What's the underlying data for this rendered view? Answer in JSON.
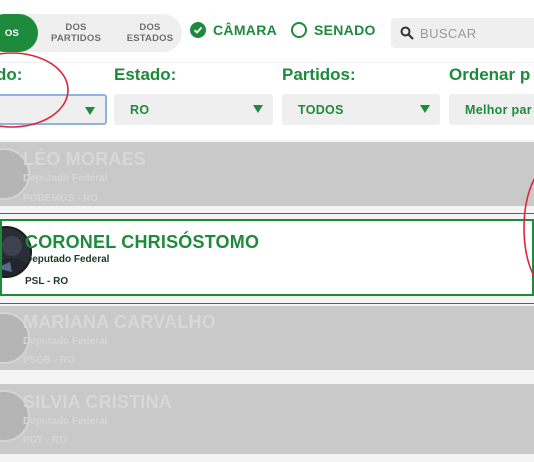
{
  "tabs": [
    {
      "label": "OS",
      "active": true
    },
    {
      "label": "DOS PARTIDOS",
      "active": false
    },
    {
      "label": "DOS ESTADOS",
      "active": false
    }
  ],
  "chamber": {
    "camara_label": "CÂMARA",
    "camara_selected": true,
    "senado_label": "SENADO",
    "senado_selected": false
  },
  "search": {
    "placeholder": "BUSCAR",
    "value": ""
  },
  "filters": {
    "cargo_label": "do:",
    "cargo_value": "",
    "estado_label": "Estado:",
    "estado_value": "RO",
    "partidos_label": "Partidos:",
    "partidos_value": "TODOS",
    "ordenar_label": "Ordenar p",
    "ordenar_value": "Melhor par"
  },
  "politicians": [
    {
      "name": "LÉO MORAES",
      "role": "Deputado Federal",
      "party": "PODEMOS - RO",
      "highlighted": false
    },
    {
      "name": "CORONEL CHRISÓSTOMO",
      "role": "Deputado Federal",
      "party": "PSL - RO",
      "highlighted": true
    },
    {
      "name": "MARIANA CARVALHO",
      "role": "Deputado Federal",
      "party": "PSDB - RO",
      "highlighted": false
    },
    {
      "name": "SILVIA CRISTINA",
      "role": "Deputado Federal",
      "party": "PDT - RO",
      "highlighted": false
    }
  ],
  "colors": {
    "accent": "#1d8a3c",
    "annotation": "#d9283a",
    "card_faded": "#c9c9c9"
  },
  "icons": {
    "check": "check-icon",
    "search": "search-icon",
    "dropdown": "chevron-down-icon"
  }
}
